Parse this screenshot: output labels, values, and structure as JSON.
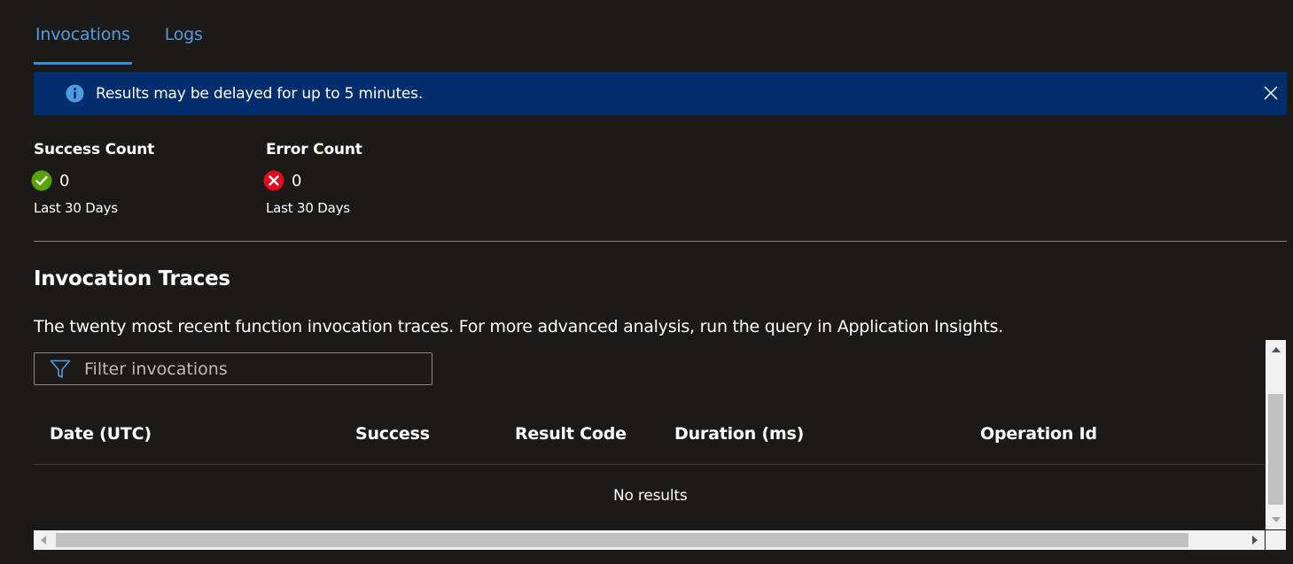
{
  "tabs": [
    {
      "label": "Invocations",
      "active": true
    },
    {
      "label": "Logs",
      "active": false
    }
  ],
  "banner": {
    "text": "Results may be delayed for up to 5 minutes.",
    "icon": "info-icon",
    "close_icon": "close-icon"
  },
  "success": {
    "title": "Success Count",
    "value": "0",
    "period": "Last 30 Days",
    "icon": "success-check-icon"
  },
  "error": {
    "title": "Error Count",
    "value": "0",
    "period": "Last 30 Days",
    "icon": "error-x-icon"
  },
  "traces": {
    "title": "Invocation Traces",
    "description": "The twenty most recent function invocation traces. For more advanced analysis, run the query in Application Insights.",
    "filter_placeholder": "Filter invocations",
    "columns": [
      "Date (UTC)",
      "Success",
      "Result Code",
      "Duration (ms)",
      "Operation Id"
    ],
    "empty_text": "No results",
    "rows": []
  },
  "colors": {
    "background": "#1b1a19",
    "accent": "#4f9ce0",
    "banner": "#002d6b",
    "success": "#57a300",
    "error": "#e00b1c"
  }
}
